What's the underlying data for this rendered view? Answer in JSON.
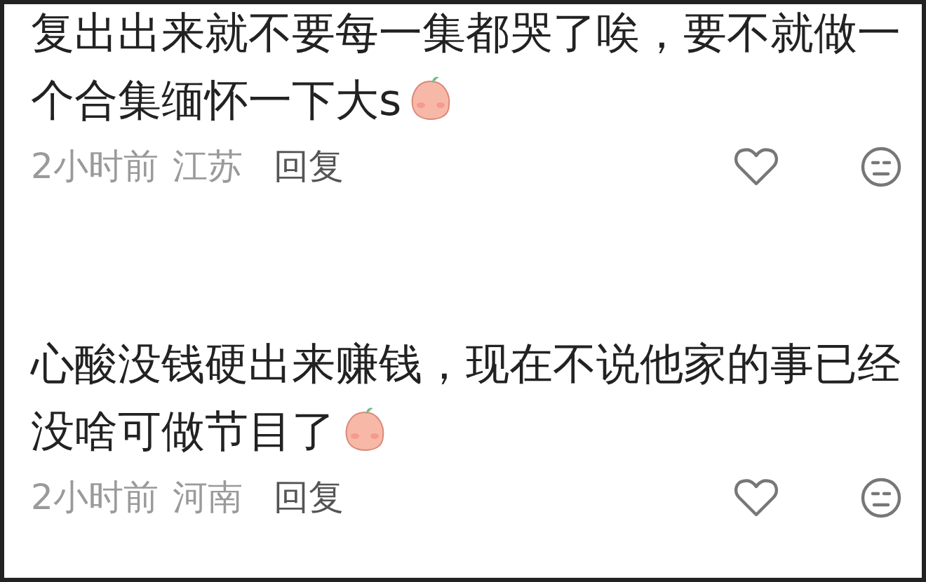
{
  "comments": [
    {
      "text": "复出出来就不要每一集都哭了唉，要不就做一个合集缅怀一下大s",
      "time": "2小时前",
      "location": "江苏",
      "reply": "回复"
    },
    {
      "text": "心酸没钱硬出来赚钱，现在不说他家的事已经没啥可做节目了",
      "time": "2小时前",
      "location": "河南",
      "reply": "回复"
    }
  ]
}
